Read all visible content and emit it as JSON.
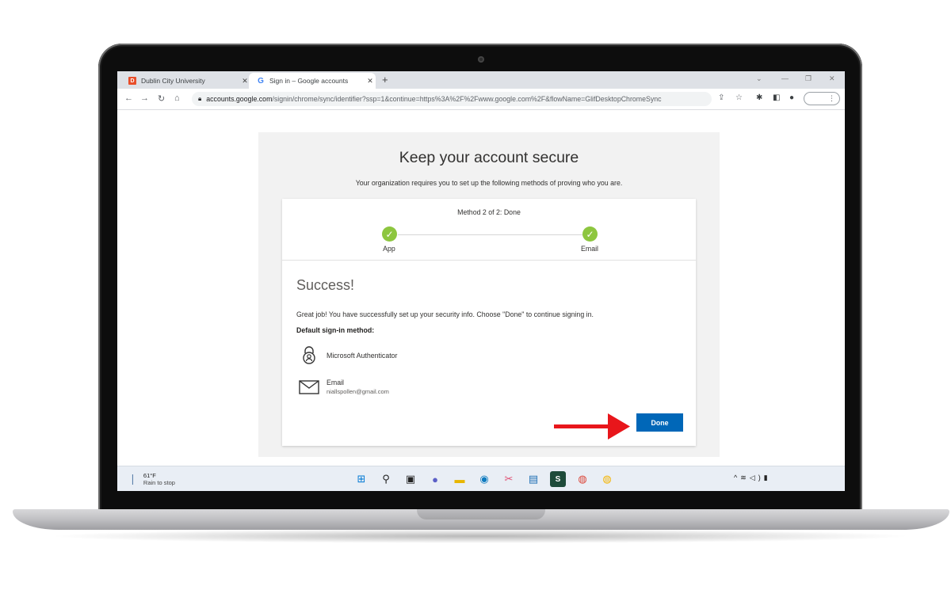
{
  "browser": {
    "tabs": [
      {
        "title": "Dublin City University",
        "favicon": "dcu-logo-icon",
        "active": false
      },
      {
        "title": "Sign in – Google accounts",
        "favicon": "google-g-icon",
        "active": true
      }
    ],
    "url_host": "accounts.google.com",
    "url_path": "/signin/chrome/sync/identifier?ssp=1&continue=https%3A%2F%2Fwww.google.com%2F&flowName=GlifDesktopChromeSync"
  },
  "page": {
    "heading": "Keep your account secure",
    "subheading": "Your organization requires you to set up the following methods of proving who you are.",
    "progress": {
      "status": "Method 2 of 2: Done",
      "steps": [
        {
          "label": "App",
          "complete": true
        },
        {
          "label": "Email",
          "complete": true
        }
      ]
    },
    "success_title": "Success!",
    "success_message": "Great job! You have successfully set up your security info. Choose \"Done\" to continue signing in.",
    "default_method_label": "Default sign-in method:",
    "methods": [
      {
        "name": "Microsoft Authenticator",
        "icon": "authenticator-lock-icon",
        "detail": ""
      },
      {
        "name": "Email",
        "icon": "envelope-icon",
        "detail": "niallspollen@gmail.com"
      }
    ],
    "done_button": "Done"
  },
  "annotation": {
    "arrow_color": "#e8161b"
  },
  "taskbar": {
    "weather_temp": "61°F",
    "weather_condition": "Rain to stop",
    "apps": [
      "start-icon",
      "search-icon",
      "task-view-icon",
      "chat-icon",
      "file-explorer-icon",
      "edge-icon",
      "snipping-tool-icon",
      "store-icon",
      "app-s-icon",
      "chrome-icon",
      "chrome-profile-icon"
    ]
  },
  "colors": {
    "accent_button": "#0067b8",
    "step_complete": "#8dc63f"
  }
}
